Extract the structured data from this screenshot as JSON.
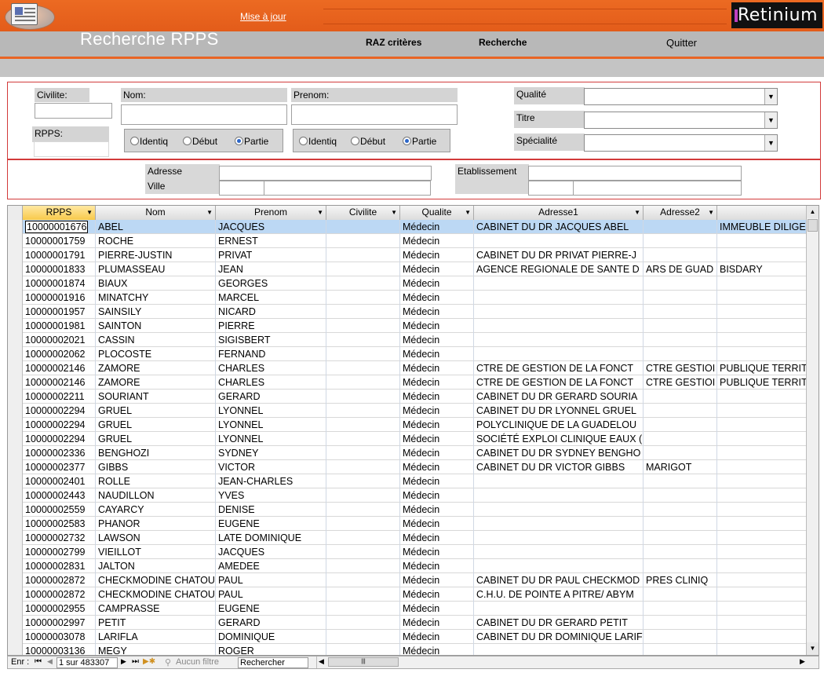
{
  "header": {
    "mise_a_jour": "Mise à jour",
    "brand": "Retinium",
    "title": "Recherche RPPS"
  },
  "toolbar": {
    "raz_label": "RAZ critères",
    "recherche_label": "Recherche",
    "quitter_label": "Quitter"
  },
  "criteria": {
    "civilite_label": "Civilite:",
    "nom_label": "Nom:",
    "prenom_label": "Prenom:",
    "rpps_label": "RPPS:",
    "qualite_label": "Qualité",
    "titre_label": "Titre",
    "specialite_label": "Spécialité",
    "adresse_label": "Adresse",
    "ville_label": "Ville",
    "etablissement_label": "Etablissement",
    "match_options": [
      "Identiq",
      "Début",
      "Partie"
    ],
    "nom_match_selected": "Partie",
    "prenom_match_selected": "Partie"
  },
  "grid": {
    "columns": [
      "RPPS",
      "Nom",
      "Prenom",
      "Civilite",
      "Qualite",
      "Adresse1",
      "Adresse2",
      ""
    ],
    "rows": [
      [
        "10000001676",
        "ABEL",
        "JACQUES",
        "",
        "Médecin",
        "CABINET DU DR JACQUES ABEL",
        "",
        "IMMEUBLE DILIGE"
      ],
      [
        "10000001759",
        "ROCHE",
        "ERNEST",
        "",
        "Médecin",
        "",
        "",
        ""
      ],
      [
        "10000001791",
        "PIERRE-JUSTIN",
        "PRIVAT",
        "",
        "Médecin",
        "CABINET DU DR PRIVAT PIERRE-J",
        "",
        ""
      ],
      [
        "10000001833",
        "PLUMASSEAU",
        "JEAN",
        "",
        "Médecin",
        "AGENCE REGIONALE DE SANTE D",
        "ARS DE GUAD",
        "BISDARY"
      ],
      [
        "10000001874",
        "BIAUX",
        "GEORGES",
        "",
        "Médecin",
        "",
        "",
        ""
      ],
      [
        "10000001916",
        "MINATCHY",
        "MARCEL",
        "",
        "Médecin",
        "",
        "",
        ""
      ],
      [
        "10000001957",
        "SAINSILY",
        "NICARD",
        "",
        "Médecin",
        "",
        "",
        ""
      ],
      [
        "10000001981",
        "SAINTON",
        "PIERRE",
        "",
        "Médecin",
        "",
        "",
        ""
      ],
      [
        "10000002021",
        "CASSIN",
        "SIGISBERT",
        "",
        "Médecin",
        "",
        "",
        ""
      ],
      [
        "10000002062",
        "PLOCOSTE",
        "FERNAND",
        "",
        "Médecin",
        "",
        "",
        ""
      ],
      [
        "10000002146",
        "ZAMORE",
        "CHARLES",
        "",
        "Médecin",
        "CTRE DE GESTION DE LA FONCT",
        "CTRE GESTIOI",
        "PUBLIQUE TERRIT"
      ],
      [
        "10000002146",
        "ZAMORE",
        "CHARLES",
        "",
        "Médecin",
        "CTRE DE GESTION DE LA FONCT",
        "CTRE GESTIOI",
        "PUBLIQUE TERRIT"
      ],
      [
        "10000002211",
        "SOURIANT",
        "GERARD",
        "",
        "Médecin",
        "CABINET DU DR GERARD SOURIA",
        "",
        ""
      ],
      [
        "10000002294",
        "GRUEL",
        "LYONNEL",
        "",
        "Médecin",
        "CABINET DU DR LYONNEL GRUEL",
        "",
        ""
      ],
      [
        "10000002294",
        "GRUEL",
        "LYONNEL",
        "",
        "Médecin",
        "POLYCLINIQUE DE LA GUADELOU",
        "",
        ""
      ],
      [
        "10000002294",
        "GRUEL",
        "LYONNEL",
        "",
        "Médecin",
        "SOCIÉTÉ EXPLOI CLINIQUE EAUX (",
        "",
        ""
      ],
      [
        "10000002336",
        "BENGHOZI",
        "SYDNEY",
        "",
        "Médecin",
        "CABINET DU DR SYDNEY BENGHO",
        "",
        ""
      ],
      [
        "10000002377",
        "GIBBS",
        "VICTOR",
        "",
        "Médecin",
        "CABINET DU DR VICTOR GIBBS",
        "MARIGOT",
        ""
      ],
      [
        "10000002401",
        "ROLLE",
        "JEAN-CHARLES",
        "",
        "Médecin",
        "",
        "",
        ""
      ],
      [
        "10000002443",
        "NAUDILLON",
        "YVES",
        "",
        "Médecin",
        "",
        "",
        ""
      ],
      [
        "10000002559",
        "CAYARCY",
        "DENISE",
        "",
        "Médecin",
        "",
        "",
        ""
      ],
      [
        "10000002583",
        "PHANOR",
        "EUGENE",
        "",
        "Médecin",
        "",
        "",
        ""
      ],
      [
        "10000002732",
        "LAWSON",
        "LATE DOMINIQUE",
        "",
        "Médecin",
        "",
        "",
        ""
      ],
      [
        "10000002799",
        "VIEILLOT",
        "JACQUES",
        "",
        "Médecin",
        "",
        "",
        ""
      ],
      [
        "10000002831",
        "JALTON",
        "AMEDEE",
        "",
        "Médecin",
        "",
        "",
        ""
      ],
      [
        "10000002872",
        "CHECKMODINE CHATOU",
        "PAUL",
        "",
        "Médecin",
        "CABINET DU DR PAUL CHECKMOD",
        "PRES CLINIQ",
        ""
      ],
      [
        "10000002872",
        "CHECKMODINE CHATOU",
        "PAUL",
        "",
        "Médecin",
        "C.H.U. DE POINTE A PITRE/ ABYM",
        "",
        ""
      ],
      [
        "10000002955",
        "CAMPRASSE",
        "EUGENE",
        "",
        "Médecin",
        "",
        "",
        ""
      ],
      [
        "10000002997",
        "PETIT",
        "GERARD",
        "",
        "Médecin",
        "CABINET DU DR GERARD PETIT",
        "",
        ""
      ],
      [
        "10000003078",
        "LARIFLA",
        "DOMINIQUE",
        "",
        "Médecin",
        "CABINET DU DR DOMINIQUE LARIF",
        "",
        ""
      ],
      [
        "10000003136",
        "MEGY",
        "ROGER",
        "",
        "Médecin",
        "",
        "",
        ""
      ]
    ]
  },
  "nav": {
    "enr_label": "Enr :",
    "record_position": "1 sur 483307",
    "filter_label": "Aucun filtre",
    "search_label": "Rechercher"
  }
}
